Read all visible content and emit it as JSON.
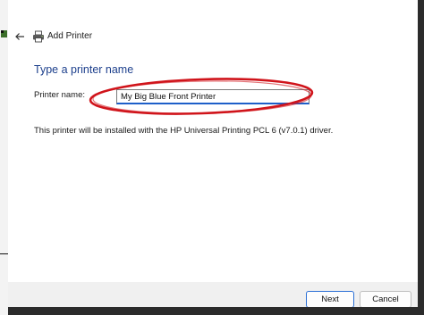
{
  "window": {
    "title": "Add Printer"
  },
  "page": {
    "heading": "Type a printer name",
    "name_label": "Printer name:",
    "name_value": "My Big Blue Front Printer",
    "driver_note": "This printer will be installed with the HP Universal Printing PCL 6 (v7.0.1) driver."
  },
  "buttons": {
    "next": "Next",
    "cancel": "Cancel"
  },
  "icons": {
    "back": "back-arrow-icon",
    "printer": "printer-icon"
  },
  "colors": {
    "heading": "#1c3f8c",
    "highlight": "#d0141b",
    "input_focus": "#1e5fc9",
    "footer": "#f0f0f0"
  }
}
